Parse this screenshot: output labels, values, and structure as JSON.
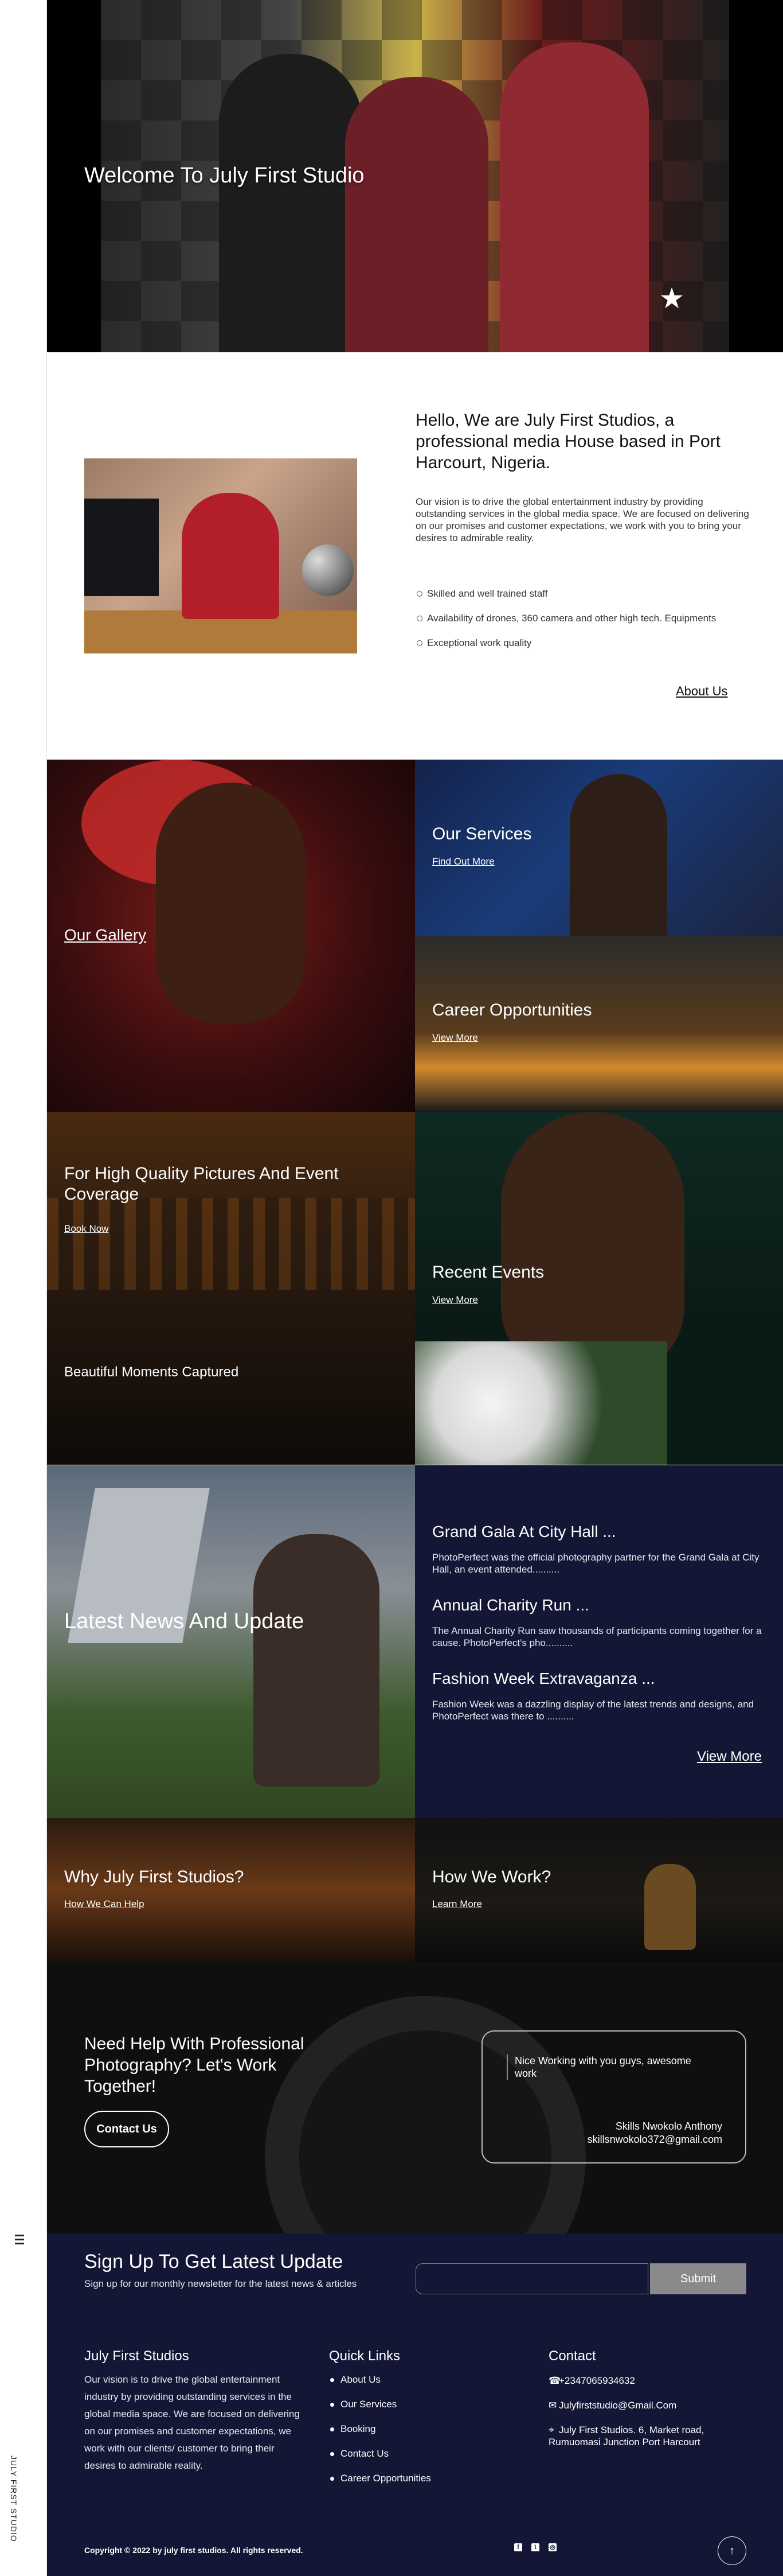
{
  "sidebar": {
    "brand_vertical": "JULY FIRST STUDIO"
  },
  "hero": {
    "title": "Welcome To July First Studio"
  },
  "about": {
    "heading": "Hello, We are July First Studios, a professional media House based in Port Harcourt, Nigeria.",
    "description": "Our vision is to drive the global entertainment industry by providing outstanding services in the global media space. We are focused on delivering on our promises and customer expectations, we work with you to bring your desires to admirable reality.",
    "features": [
      "Skilled and well trained staff",
      "Availability of drones, 360 camera and other high tech. Equipments",
      "Exceptional work quality"
    ],
    "link": "About Us"
  },
  "tiles": {
    "gallery": {
      "title": "Our Gallery"
    },
    "services": {
      "title": "Our Services",
      "link": "Find Out More"
    },
    "career": {
      "title": "Career Opportunities",
      "link": "View More"
    },
    "quality": {
      "title": "For High Quality Pictures And Event Coverage",
      "link": "Book Now",
      "caption": "Beautiful Moments Captured"
    },
    "events": {
      "title": "Recent Events",
      "link": "View More"
    }
  },
  "news": {
    "title": "Latest News And Update",
    "items": [
      {
        "title": "Grand Gala At City Hall ...",
        "desc": "PhotoPerfect was the official photography partner for the Grand Gala at City Hall, an event attended.........."
      },
      {
        "title": "Annual Charity Run ...",
        "desc": "The Annual Charity Run saw thousands of participants coming together for a cause. PhotoPerfect's pho.........."
      },
      {
        "title": "Fashion Week Extravaganza ...",
        "desc": "Fashion Week was a dazzling display of the latest trends and designs, and PhotoPerfect was there to .........."
      }
    ],
    "more": "View More"
  },
  "why": {
    "title": "Why July First Studios?",
    "link": "How We Can Help"
  },
  "how": {
    "title": "How We Work?",
    "link": "Learn More"
  },
  "cta": {
    "title": "Need Help With Professional Photography? Let's Work Together!",
    "button": "Contact Us",
    "testimonial": {
      "quote": "Nice Working with you guys, awesome work",
      "name": "Skills Nwokolo Anthony",
      "email": "skillsnwokolo372@gmail.com"
    }
  },
  "newsletter": {
    "title": "Sign Up To Get Latest Update",
    "subtitle": "Sign up for our monthly newsletter for the latest news & articles",
    "input_value": "",
    "button": "Submit"
  },
  "footer": {
    "about_title": "July First Studios",
    "about_text": "Our vision is to drive the global entertainment industry by providing outstanding services in the global media space. We are focused on delivering on our promises and customer expectations, we work with our clients/ customer to bring their desires to admirable reality.",
    "quick_links_title": "Quick Links",
    "quick_links": [
      "About Us",
      "Our Services",
      "Booking",
      "Contact Us",
      "Career Opportunities"
    ],
    "contact_title": "Contact",
    "phone": "+2347065934632",
    "email": "Julyfirststudio@Gmail.Com",
    "address": "July First Studios. 6, Market road, Rumuomasi Junction Port Harcourt",
    "copyright": "Copyright © 2022 by july first studios. All rights reserved.",
    "socials": [
      "facebook-icon",
      "twitter-icon",
      "instagram-icon"
    ]
  }
}
